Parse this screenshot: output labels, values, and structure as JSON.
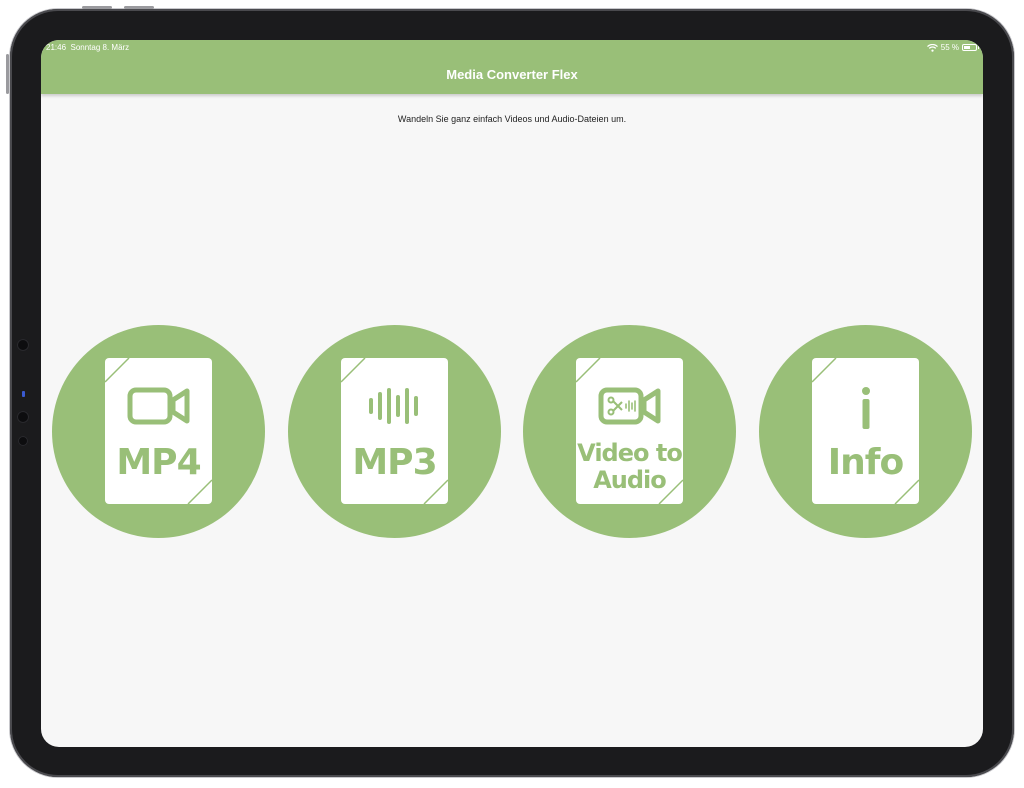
{
  "status_bar": {
    "time": "21:46",
    "date": "Sonntag 8. März",
    "battery": "55 %",
    "battery_level": 0.55
  },
  "header": {
    "title": "Media Converter Flex"
  },
  "subtitle": "Wandeln Sie ganz einfach Videos und Audio-Dateien um.",
  "colors": {
    "accent": "#99bf78",
    "background": "#f7f7f7"
  },
  "tiles": [
    {
      "icon": "video-camera-icon",
      "label": "MP4"
    },
    {
      "icon": "audio-wave-icon",
      "label": "MP3"
    },
    {
      "icon": "video-to-audio-icon",
      "label_line1": "Video to",
      "label_line2": "Audio"
    },
    {
      "icon": "info-icon",
      "label": "Info"
    }
  ]
}
